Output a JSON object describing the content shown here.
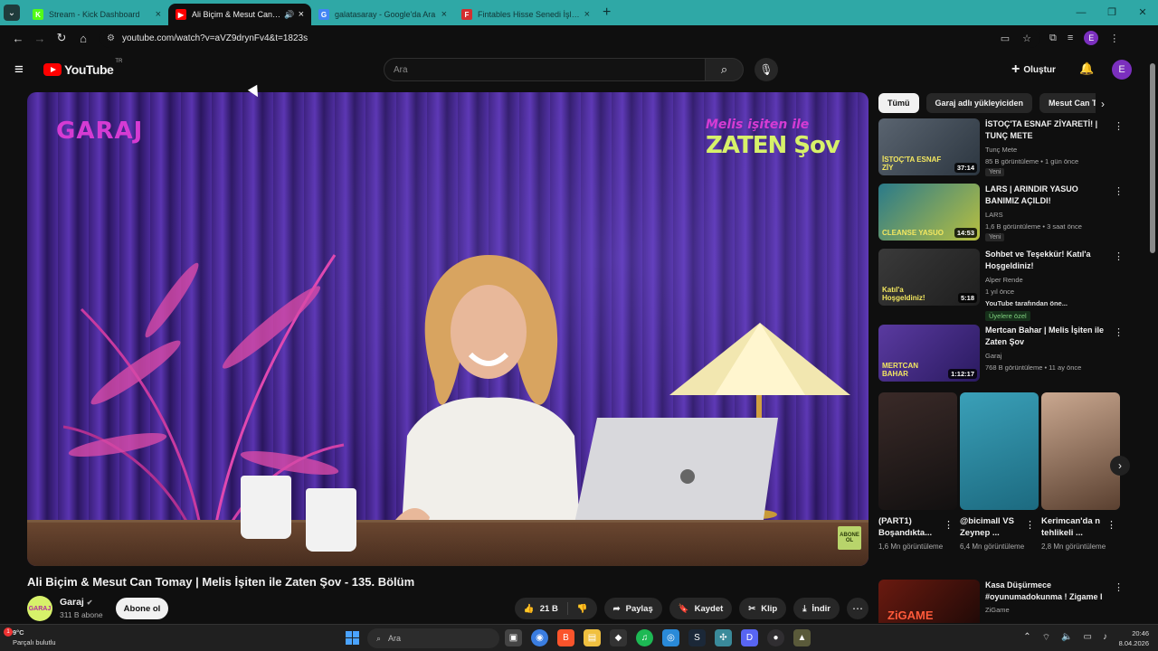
{
  "browser": {
    "tabs": [
      {
        "title": "Stream - Kick Dashboard",
        "favicon": "K",
        "color": "#53fc18",
        "active": false
      },
      {
        "title": "Ali Biçim & Mesut Can Tom...",
        "favicon": "▶",
        "color": "#ff0000",
        "active": true,
        "audio": "🔊"
      },
      {
        "title": "galatasaray - Google'da Ara",
        "favicon": "G",
        "color": "#4285f4",
        "active": false
      },
      {
        "title": "Fintables Hisse Senedi İşlem Ek...",
        "favicon": "F",
        "color": "#d32f2f",
        "active": false
      }
    ],
    "url": "youtube.com/watch?v=aVZ9drynFv4&t=1823s",
    "profile_letter": "E"
  },
  "youtube": {
    "logo_text": "YouTube",
    "logo_country": "TR",
    "search_placeholder": "Ara",
    "create_label": "Oluştur",
    "avatar_letter": "E"
  },
  "video": {
    "title": "Ali Biçim & Mesut Can Tomay | Melis İşiten ile Zaten Şov - 135. Bölüm",
    "overlay_brand": "GARAJ",
    "overlay_show_line1": "Melis işiten ile",
    "overlay_show_line2": "ZATEN Şov",
    "abone_badge": "ABONE OL",
    "channel": {
      "name": "Garaj",
      "subscribers": "311 B abone",
      "avatar_text": "GARAJ"
    },
    "subscribe_label": "Abone ol",
    "likes": "21 B",
    "share_label": "Paylaş",
    "save_label": "Kaydet",
    "clip_label": "Klip",
    "download_label": "İndir"
  },
  "chips": [
    "Tümü",
    "Garaj adlı yükleyiciden",
    "Mesut Can Tom"
  ],
  "recommendations": [
    {
      "title": "İSTOÇ'TA ESNAF ZİYARETİ! | TUNÇ METE",
      "channel": "Tunç Mete",
      "meta": "85 B görüntüleme • 1 gün önce",
      "tag": "Yeni",
      "duration": "37:14",
      "thumb_caption": "İSTOÇ'TA ESNAF ZİY",
      "colors": [
        "#5a6470",
        "#2c3640"
      ]
    },
    {
      "title": "LARS | ARINDIR YASUO BANIMIZ AÇILDI!",
      "channel": "LARS",
      "meta": "1,6 B görüntüleme • 3 saat önce",
      "tag": "Yeni",
      "duration": "14:53",
      "thumb_caption": "CLEANSE YASUO",
      "colors": [
        "#2a7a8a",
        "#b8c040"
      ]
    },
    {
      "title": "Sohbet ve Teşekkür! Katıl'a Hoşgeldiniz!",
      "channel": "Alper Rende",
      "meta": "1 yıl önce",
      "extra": "YouTube tarafından öne...",
      "badge": "Üyelere özel",
      "duration": "5:18",
      "thumb_caption": "Katıl'a Hoşgeldiniz!",
      "colors": [
        "#3a3a3a",
        "#1e1e1e"
      ]
    },
    {
      "title": "Mertcan Bahar | Melis İşiten ile Zaten Şov",
      "channel": "Garaj",
      "meta": "768 B görüntüleme • 11 ay önce",
      "duration": "1:12:17",
      "thumb_caption": "MERTCAN BAHAR",
      "colors": [
        "#5a3aa0",
        "#2a1a60"
      ]
    }
  ],
  "shorts": [
    {
      "title": "(PART1) Boşandıkta...",
      "views": "1,6 Mn görüntüleme",
      "colors": [
        "#3a2a28",
        "#121010"
      ]
    },
    {
      "title": "@bicimall VS Zeynep ...",
      "views": "6,4 Mn görüntüleme",
      "colors": [
        "#3aa0b8",
        "#1c6a80"
      ]
    },
    {
      "title": "Kerimcan'da n tehlikeli ...",
      "views": "2,8 Mn görüntüleme",
      "colors": [
        "#caa890",
        "#5a4030"
      ]
    }
  ],
  "last_recommendation": {
    "title": "Kasa Düşürmece #oyunumadokunma ! Zigame I",
    "channel": "ZiGame",
    "thumb_caption": "ZiGAME"
  },
  "taskbar": {
    "weather_temp": "9°C",
    "weather_desc": "Parçalı bulutlu",
    "search_placeholder": "Ara",
    "time": "20:46",
    "date": "8.04.2026",
    "notif_count": "1"
  }
}
